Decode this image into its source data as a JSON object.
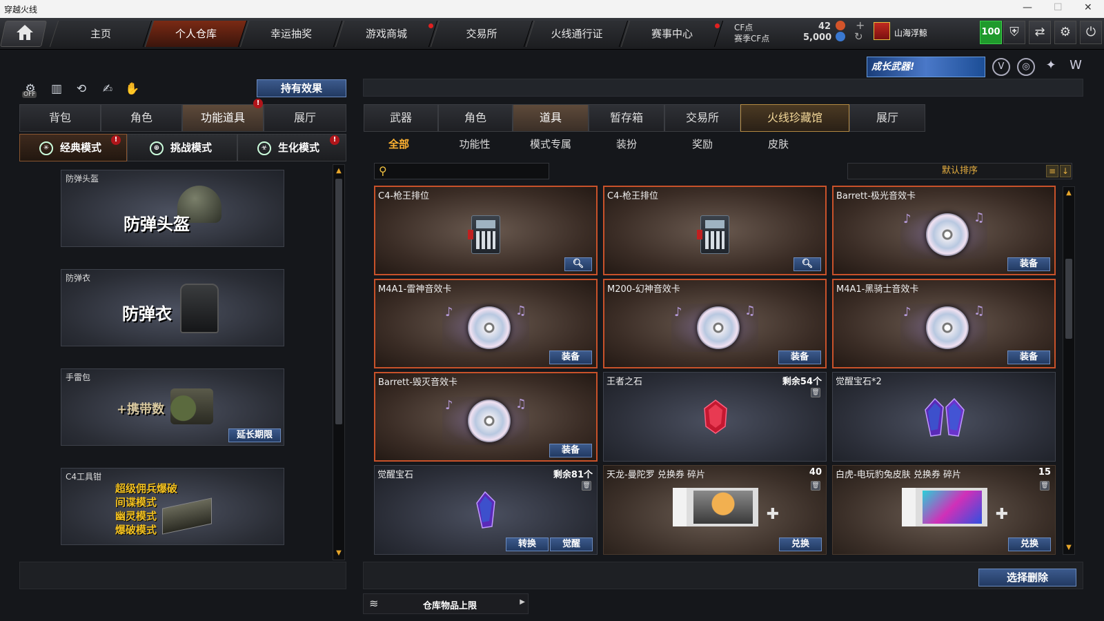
{
  "window": {
    "title": "穿越火线"
  },
  "nav": {
    "tabs": [
      {
        "label": "主页"
      },
      {
        "label": "个人仓库"
      },
      {
        "label": "幸运抽奖"
      },
      {
        "label": "游戏商城"
      },
      {
        "label": "交易所"
      },
      {
        "label": "火线通行证"
      },
      {
        "label": "赛事中心"
      }
    ],
    "active_index": 1
  },
  "currency": {
    "cf_label": "CF点",
    "cf_value": "42",
    "season_label": "赛季CF点",
    "season_value": "5,000"
  },
  "user": {
    "name": "山海浮鲸",
    "level": "100"
  },
  "banner": {
    "text": "成长武器!"
  },
  "left": {
    "effect_button": "持有效果",
    "off_label": "OFF",
    "tabs": [
      "背包",
      "角色",
      "功能道具",
      "展厅"
    ],
    "modes": [
      "经典模式",
      "挑战模式",
      "生化模式"
    ],
    "items": [
      {
        "name": "防弹头盔",
        "title": "防弹头盔"
      },
      {
        "name": "防弹衣",
        "title": "防弹衣"
      },
      {
        "name": "手雷包",
        "title": "+携带数",
        "button": "延长期限"
      },
      {
        "name": "C4工具钳",
        "lines": [
          "超级佣兵爆破",
          "间谍模式",
          "幽灵模式",
          "爆破模式"
        ]
      }
    ]
  },
  "right": {
    "tabs": [
      "武器",
      "角色",
      "道具",
      "暂存箱",
      "交易所",
      "火线珍藏馆",
      "展厅"
    ],
    "subtabs": [
      "全部",
      "功能性",
      "模式专属",
      "装扮",
      "奖励",
      "皮肤"
    ],
    "sort_label": "默认排序",
    "items": [
      {
        "name": "C4-枪王排位",
        "icon": "c4-icon"
      },
      {
        "name": "C4-枪王排位",
        "icon": "c4-icon"
      },
      {
        "name": "Barrett-极光音效卡",
        "button": "装备"
      },
      {
        "name": "M4A1-雷神音效卡",
        "button": "装备"
      },
      {
        "name": "M200-幻神音效卡",
        "button": "装备"
      },
      {
        "name": "M4A1-黑骑士音效卡",
        "button": "装备"
      },
      {
        "name": "Barrett-毁灭音效卡",
        "button": "装备"
      },
      {
        "name": "王者之石",
        "qty": "剩余54个"
      },
      {
        "name": "觉醒宝石*2"
      },
      {
        "name": "觉醒宝石",
        "qty": "剩余81个",
        "button1": "转换",
        "button2": "觉醒"
      },
      {
        "name": "天龙-曼陀罗 兑换券 碎片",
        "qty": "40",
        "button": "兑换"
      },
      {
        "name": "白虎-电玩豹兔皮肤 兑换券 碎片",
        "qty": "15",
        "button": "兑换"
      }
    ],
    "delete_button": "选择删除",
    "storage_limit": "仓库物品上限"
  }
}
